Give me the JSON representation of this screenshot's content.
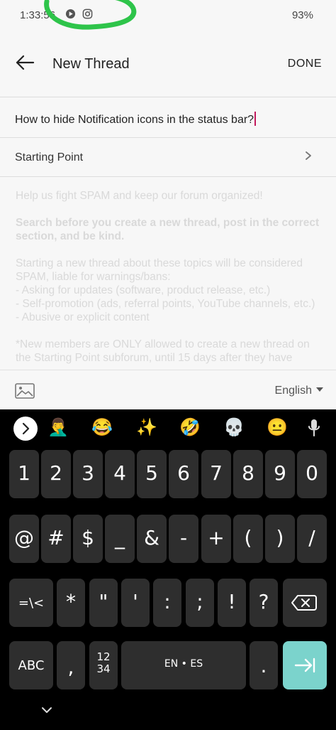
{
  "status_bar": {
    "time": "1:33:56",
    "battery": "93%"
  },
  "header": {
    "title": "New Thread",
    "done_label": "DONE"
  },
  "thread_title_input": {
    "value": "How to hide Notification icons in the status bar?"
  },
  "starting_point": {
    "label": "Starting Point"
  },
  "guidelines": {
    "intro": "Help us fight SPAM and keep our forum organized!",
    "bold": "Search before you create a new thread, post in the correct section, and be kind.",
    "spam_intro": "Starting a new thread about these topics will be considered SPAM, liable for warnings/bans:",
    "items": [
      " - Asking for updates (software, product release, etc.)",
      " - Self-promotion (ads, referral points, YouTube channels, etc.)",
      " - Abusive or explicit content"
    ],
    "new_members": "*New members are ONLY allowed to create a new thread on the Starting Point subforum, until 15 days after they have"
  },
  "editor_bar": {
    "language": "English"
  },
  "keyboard": {
    "suggestion_emojis": [
      "🤦‍♂️",
      "😂",
      "✨",
      "🤣",
      "💀",
      "😐"
    ],
    "row1": [
      "1",
      "2",
      "3",
      "4",
      "5",
      "6",
      "7",
      "8",
      "9",
      "0"
    ],
    "row2": [
      "@",
      "#",
      "$",
      "_",
      "&",
      "-",
      "+",
      "(",
      ")",
      "/"
    ],
    "row3": [
      "=\\<",
      "*",
      "\"",
      "'",
      ":",
      ";",
      "!",
      "?"
    ],
    "abc": "ABC",
    "comma": ",",
    "num_top": "12",
    "num_bottom": "34",
    "space": "EN • ES",
    "period": "."
  },
  "colors": {
    "accent_enter": "#7bd3cc",
    "caret": "#c2185b",
    "scribble": "#2ec44a"
  }
}
